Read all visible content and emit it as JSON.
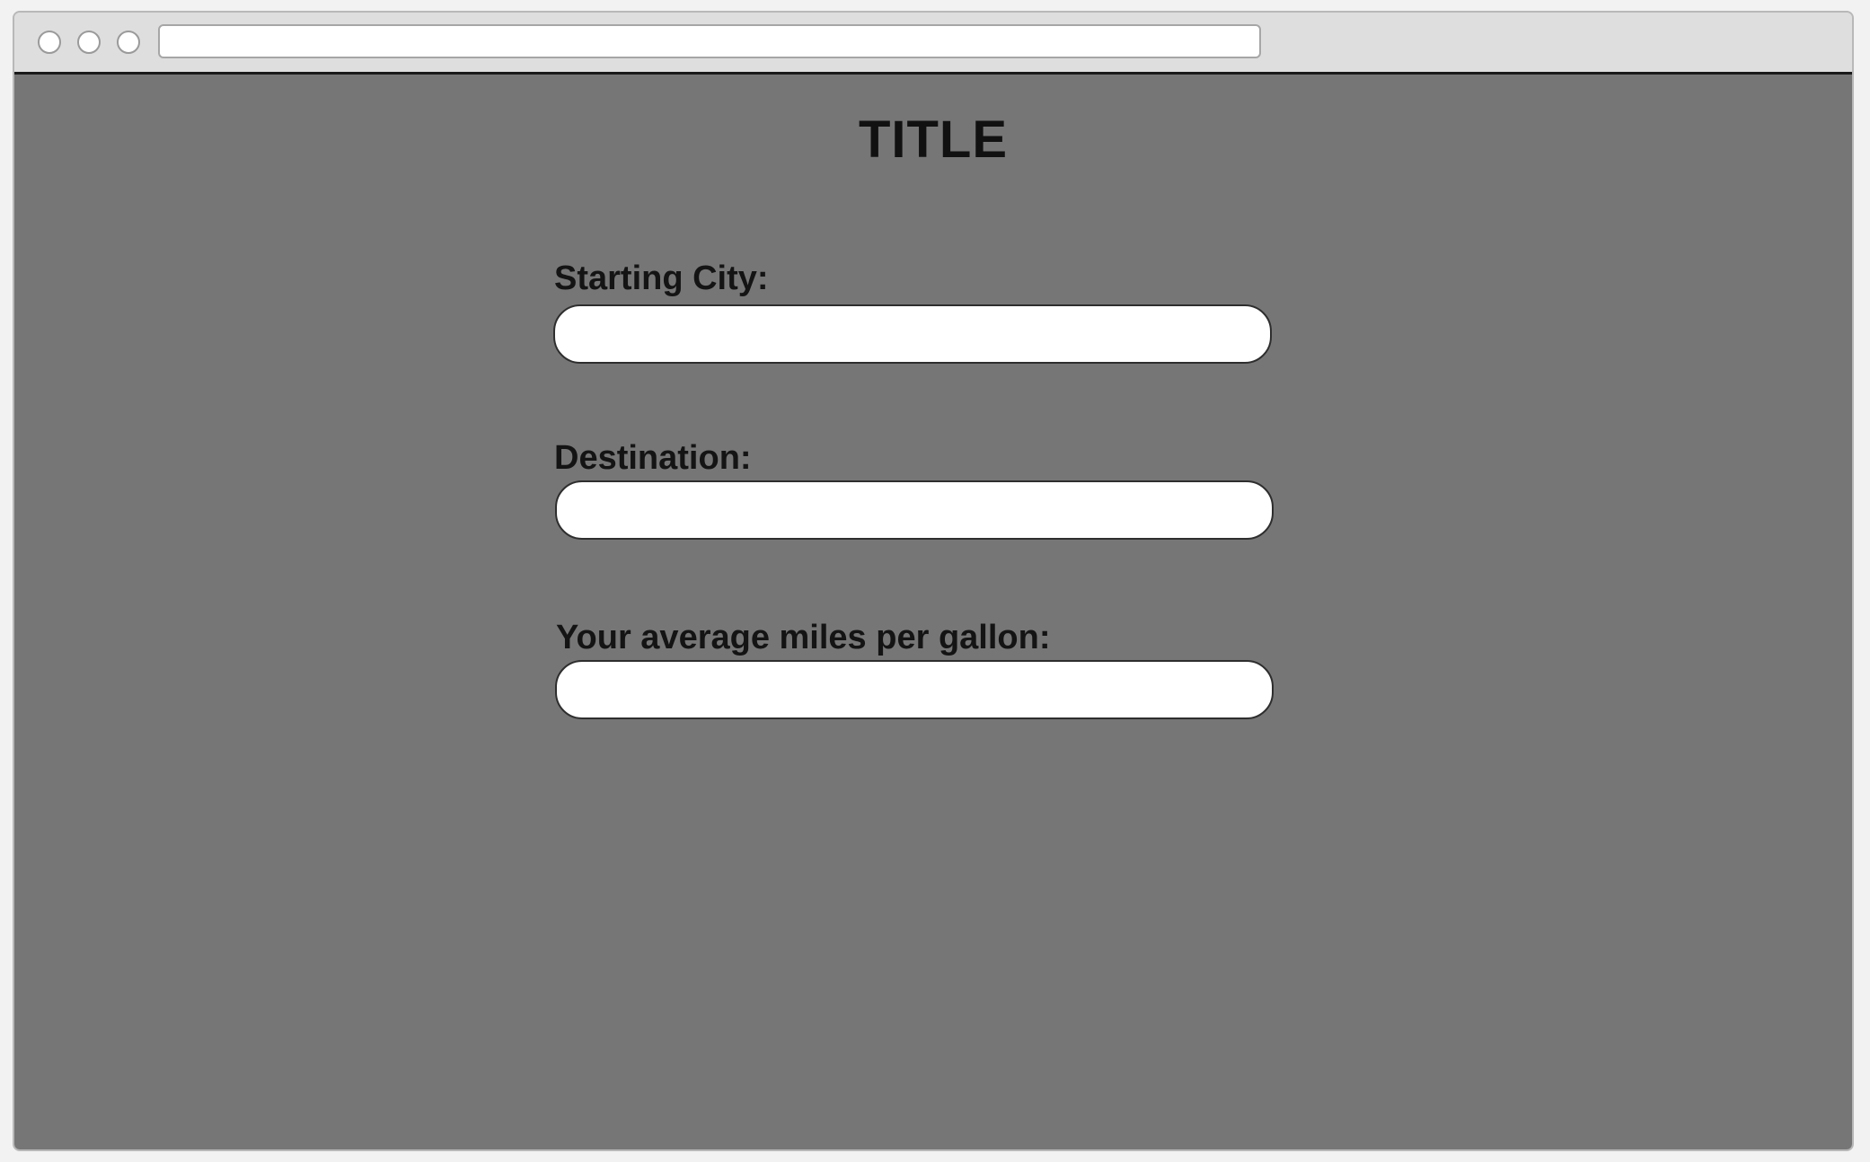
{
  "browser": {
    "url": ""
  },
  "page": {
    "title": "TITLE"
  },
  "form": {
    "starting_city": {
      "label": "Starting City:",
      "value": "",
      "placeholder": ""
    },
    "destination": {
      "label": "Destination:",
      "value": "",
      "placeholder": ""
    },
    "mpg": {
      "label": "Your average miles per gallon:",
      "value": "",
      "placeholder": ""
    }
  },
  "colors": {
    "page_background": "#767676",
    "chrome_background": "#dedede",
    "input_background": "#ffffff",
    "text": "#111111"
  }
}
